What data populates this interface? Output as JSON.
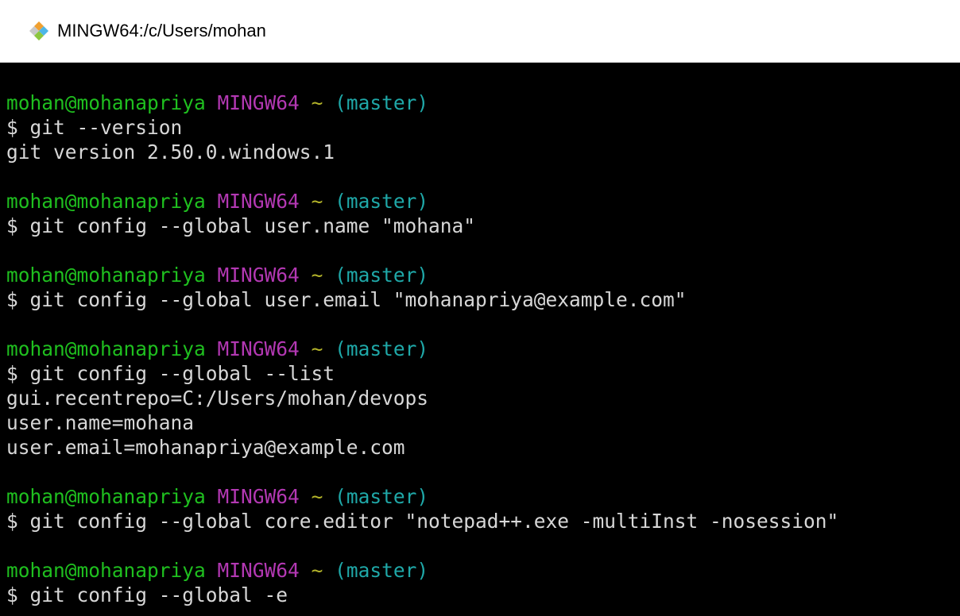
{
  "window": {
    "title": "MINGW64:/c/Users/mohan",
    "icon": "git-bash-icon"
  },
  "colors": {
    "user": "#1fbf1f",
    "shell": "#b338b3",
    "tilde": "#b5b52a",
    "branch": "#1fa8a8",
    "text": "#d7d7d7",
    "background": "#000000"
  },
  "prompt": {
    "user": "mohan@mohanapriya",
    "shell": "MINGW64",
    "path": "~",
    "branch": "(master)"
  },
  "blocks": [
    {
      "command": "$ git --version",
      "output": [
        "git version 2.50.0.windows.1"
      ]
    },
    {
      "command": "$ git config --global user.name \"mohana\"",
      "output": []
    },
    {
      "command": "$ git config --global user.email \"mohanapriya@example.com\"",
      "output": []
    },
    {
      "command": "$ git config --global --list",
      "output": [
        "gui.recentrepo=C:/Users/mohan/devops",
        "user.name=mohana",
        "user.email=mohanapriya@example.com"
      ]
    },
    {
      "command": "$ git config --global core.editor \"notepad++.exe -multiInst -nosession\"",
      "output": []
    },
    {
      "command": "$ git config --global -e",
      "output": []
    }
  ]
}
